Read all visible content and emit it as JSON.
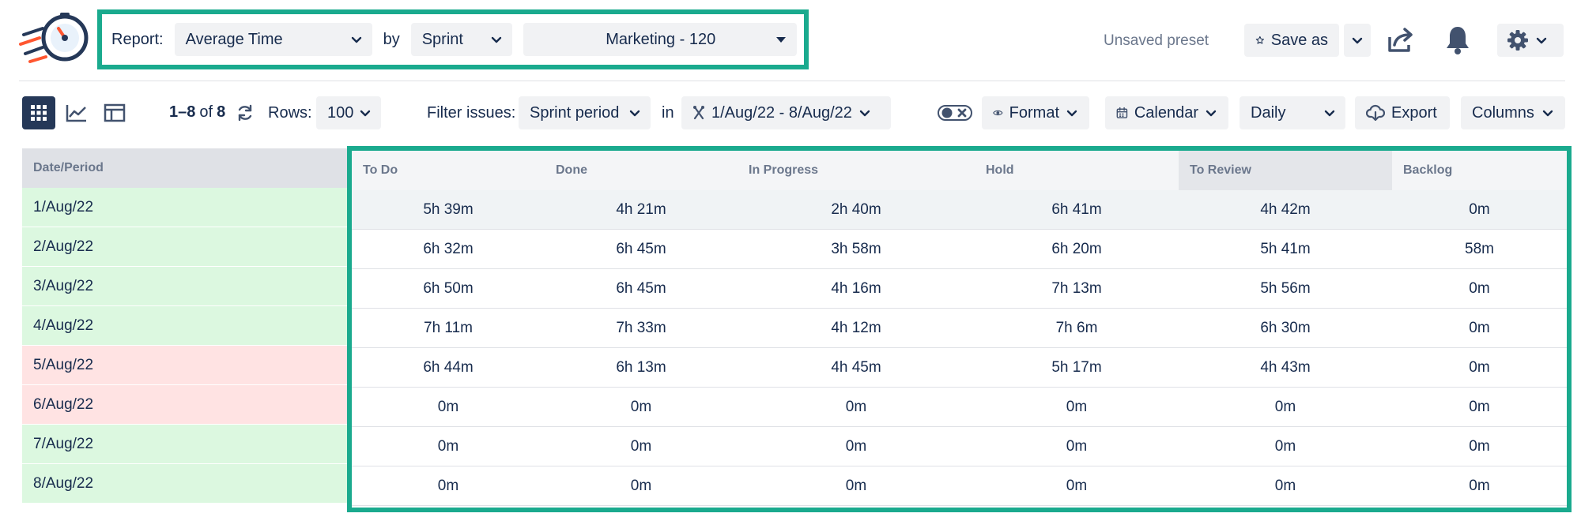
{
  "header": {
    "report_label": "Report:",
    "report_value": "Average Time",
    "by_label": "by",
    "by_value": "Sprint",
    "sprint_value": "Marketing - 120",
    "unsaved_text": "Unsaved preset",
    "save_as_label": "Save as"
  },
  "toolbar": {
    "pagination": {
      "start": "1",
      "dash": "–",
      "end": "8",
      "of": "of",
      "total": "8"
    },
    "rows_label": "Rows:",
    "rows_value": "100",
    "filter_label": "Filter issues:",
    "filter_value": "Sprint period",
    "in_label": "in",
    "date_range": "1/Aug/22 - 8/Aug/22",
    "format_label": "Format",
    "calendar_label": "Calendar",
    "granularity_value": "Daily",
    "export_label": "Export",
    "columns_label": "Columns"
  },
  "table": {
    "first_header": "Date/Period",
    "columns": [
      "To Do",
      "Done",
      "In Progress",
      "Hold",
      "To Review",
      "Backlog"
    ],
    "rows": [
      {
        "date": "1/Aug/22",
        "status": "green",
        "values": [
          "5h 39m",
          "4h 21m",
          "2h 40m",
          "6h 41m",
          "4h 42m",
          "0m"
        ]
      },
      {
        "date": "2/Aug/22",
        "status": "green",
        "values": [
          "6h 32m",
          "6h 45m",
          "3h 58m",
          "6h 20m",
          "5h 41m",
          "58m"
        ]
      },
      {
        "date": "3/Aug/22",
        "status": "green",
        "values": [
          "6h 50m",
          "6h 45m",
          "4h 16m",
          "7h 13m",
          "5h 56m",
          "0m"
        ]
      },
      {
        "date": "4/Aug/22",
        "status": "green",
        "values": [
          "7h 11m",
          "7h 33m",
          "4h 12m",
          "7h 6m",
          "6h 30m",
          "0m"
        ]
      },
      {
        "date": "5/Aug/22",
        "status": "red",
        "values": [
          "6h 44m",
          "6h 13m",
          "4h 45m",
          "5h 17m",
          "4h 43m",
          "0m"
        ]
      },
      {
        "date": "6/Aug/22",
        "status": "red",
        "values": [
          "0m",
          "0m",
          "0m",
          "0m",
          "0m",
          "0m"
        ]
      },
      {
        "date": "7/Aug/22",
        "status": "green",
        "values": [
          "0m",
          "0m",
          "0m",
          "0m",
          "0m",
          "0m"
        ]
      },
      {
        "date": "8/Aug/22",
        "status": "green",
        "values": [
          "0m",
          "0m",
          "0m",
          "0m",
          "0m",
          "0m"
        ]
      }
    ]
  },
  "colors": {
    "highlight_border": "#1aaa8e",
    "weekday_row": "#dcf8e0",
    "weekend_row": "#ffe3e3",
    "text": "#172b4d"
  },
  "icons": [
    "stopwatch-logo-icon",
    "star-icon",
    "share-icon",
    "bell-icon",
    "gear-icon",
    "grid-view-icon",
    "chart-view-icon",
    "table-view-icon",
    "refresh-icon",
    "sprint-icon",
    "toggle-icon",
    "eye-icon",
    "calendar-icon",
    "cloud-download-icon"
  ]
}
